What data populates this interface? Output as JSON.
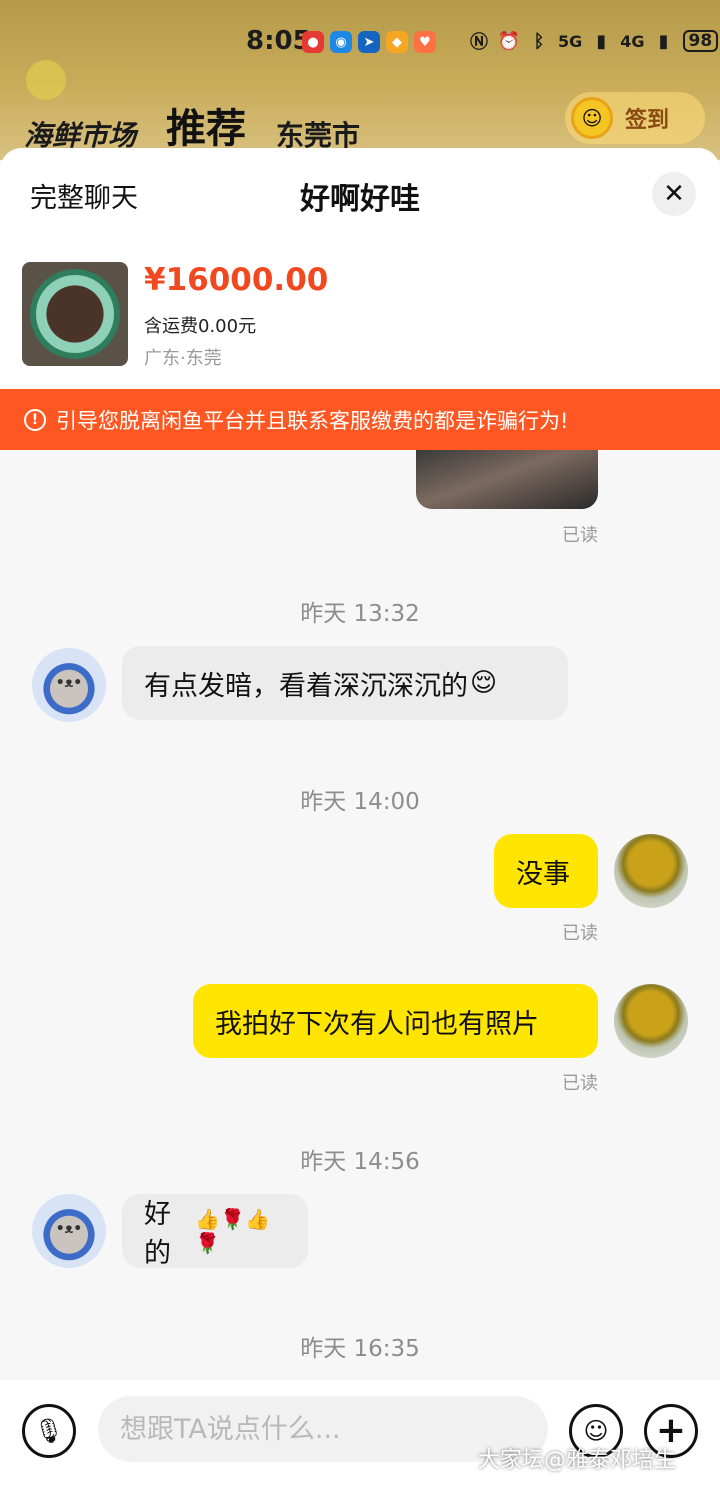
{
  "status_bar": {
    "time": "8:05",
    "network_1": "5G",
    "network_2": "4G",
    "battery": "98"
  },
  "background_app": {
    "tabs": [
      "海鲜市场",
      "推荐",
      "东莞市"
    ],
    "signin_label": "签到"
  },
  "chat_header": {
    "full_chat_label": "完整聊天",
    "title": "好啊好哇",
    "close_icon": "close-icon"
  },
  "product": {
    "price": "¥16000.00",
    "shipping": "含运费0.00元",
    "location": "广东·东莞"
  },
  "warning": {
    "text": "引导您脱离闲鱼平台并且联系客服缴费的都是诈骗行为!"
  },
  "messages": {
    "read_label": "已读",
    "ts_1": "昨天 13:32",
    "msg_1": "有点发暗，看着深沉深沉的",
    "msg_1_emoji": "😌",
    "ts_2": "昨天 14:00",
    "msg_2": "没事",
    "msg_3": "我拍好下次有人问也有照片",
    "ts_3": "昨天 14:56",
    "msg_4": "好的",
    "msg_4_emoji": "👍🌹👍🌹",
    "ts_4": "昨天 16:35"
  },
  "input": {
    "placeholder": "想跟TA说点什么..."
  },
  "watermark": "大家坛@雅泰邓培生",
  "colors": {
    "warning_bg": "#ff5722",
    "price": "#f2481f",
    "outgoing_bubble": "#ffe500",
    "incoming_bubble": "#ececec"
  }
}
